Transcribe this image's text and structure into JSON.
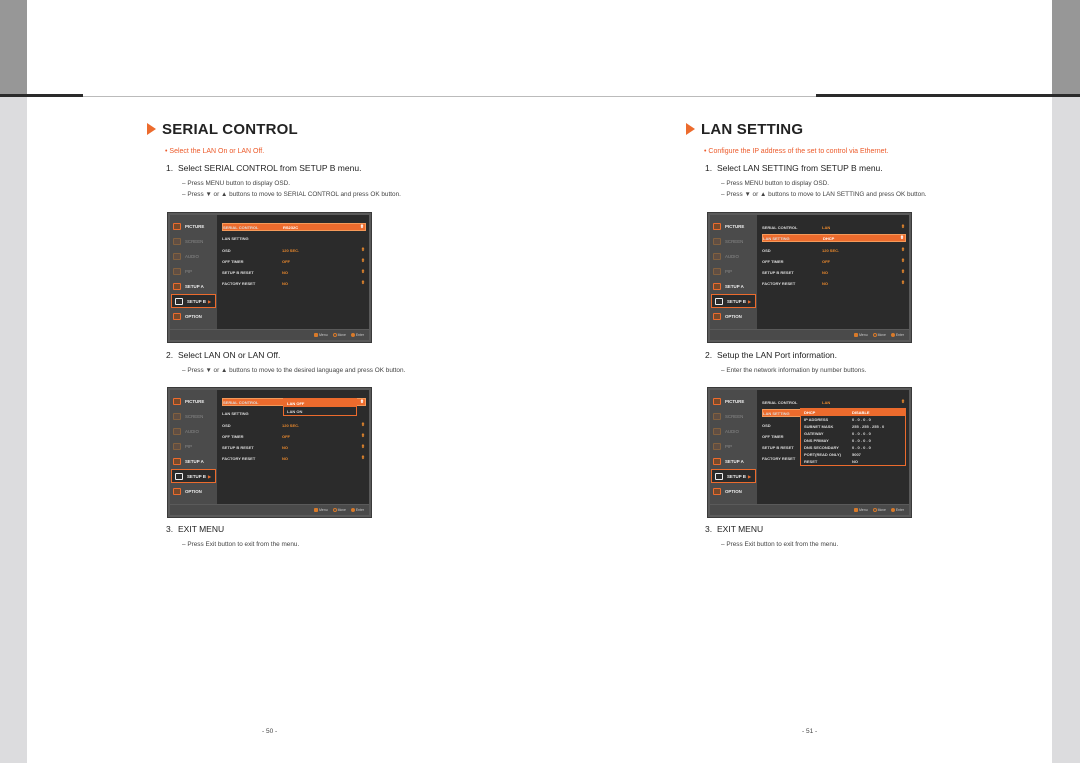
{
  "left_page": {
    "title": "SERIAL CONTROL",
    "note": "• Select the LAN On or LAN Off.",
    "steps": [
      {
        "num": "1.",
        "text": "Select SERIAL CONTROL from SETUP B menu.",
        "subs": [
          "–  Press MENU button to display OSD.",
          "–  Press ▼ or ▲ buttons to move to SERIAL CONTROL and press OK button."
        ]
      },
      {
        "num": "2.",
        "text": "Select LAN ON or LAN Off.",
        "subs": [
          "–  Press ▼ or ▲ buttons to move to the desired language and press OK button."
        ]
      },
      {
        "num": "3.",
        "text": "EXIT MENU",
        "subs": [
          "–  Press Exit button to exit from the menu."
        ]
      }
    ],
    "page_number": "- 50 -"
  },
  "right_page": {
    "title": "LAN SETTING",
    "note": "• Configure the IP address of the set to control via Ethernet.",
    "steps": [
      {
        "num": "1.",
        "text": "Select LAN SETTING from SETUP B menu.",
        "subs": [
          "–  Press MENU button to display OSD.",
          "–  Press ▼ or ▲ buttons to move to LAN SETTING and press OK button."
        ]
      },
      {
        "num": "2.",
        "text": "Setup the LAN Port information.",
        "subs": [
          "–  Enter the network information by number buttons."
        ]
      },
      {
        "num": "3.",
        "text": "EXIT MENU",
        "subs": [
          "–  Press Exit button to exit from the menu."
        ]
      }
    ],
    "page_number": "- 51 -"
  },
  "osd": {
    "sidebar": [
      {
        "label": "PICTURE",
        "icon": "picture-icon",
        "dim": false
      },
      {
        "label": "SCREEN",
        "icon": "screen-icon",
        "dim": true
      },
      {
        "label": "AUDIO",
        "icon": "audio-icon",
        "dim": true
      },
      {
        "label": "PIP",
        "icon": "pip-icon",
        "dim": true
      },
      {
        "label": "SETUP A",
        "icon": "setup-a-icon",
        "dim": false
      },
      {
        "label": "SETUP B",
        "icon": "setup-b-icon",
        "dim": false,
        "active": true
      },
      {
        "label": "OPTION",
        "icon": "option-icon",
        "dim": false
      }
    ],
    "footer": {
      "menu": "Menu",
      "move": "Move",
      "enter": "Enter"
    },
    "screen1": {
      "rows": [
        {
          "label": "SERIAL CONTROL",
          "value": "RS232C",
          "highlight": true
        },
        {
          "label": "LAN SETTING",
          "value": ""
        },
        {
          "label": "OSD",
          "value": "120 SEC."
        },
        {
          "label": "OFF TIMER",
          "value": "OFF"
        },
        {
          "label": "SETUP B RESET",
          "value": "NO"
        },
        {
          "label": "FACTORY RESET",
          "value": "NO"
        }
      ]
    },
    "screen2": {
      "rows": [
        {
          "label": "SERIAL CONTROL",
          "value": "",
          "highlight": true
        },
        {
          "label": "LAN SETTING",
          "value": ""
        },
        {
          "label": "OSD",
          "value": "120 SEC."
        },
        {
          "label": "OFF TIMER",
          "value": "OFF"
        },
        {
          "label": "SETUP B RESET",
          "value": "NO"
        },
        {
          "label": "FACTORY RESET",
          "value": "NO"
        }
      ],
      "popup": [
        "LAN OFF",
        "LAN ON"
      ]
    },
    "screen3": {
      "rows": [
        {
          "label": "SERIAL CONTROL",
          "value": "LAN"
        },
        {
          "label": "LAN SETTING",
          "value": "DHCP",
          "highlight": true
        },
        {
          "label": "OSD",
          "value": "120 SEC."
        },
        {
          "label": "OFF TIMER",
          "value": "OFF"
        },
        {
          "label": "SETUP B RESET",
          "value": "NO"
        },
        {
          "label": "FACTORY RESET",
          "value": "NO"
        }
      ]
    },
    "screen4": {
      "rows": [
        {
          "label": "SERIAL CONTROL",
          "value": "LAN"
        },
        {
          "label": "LAN SETTING",
          "value": "",
          "highlight": true
        },
        {
          "label": "OSD",
          "value": ""
        },
        {
          "label": "OFF TIMER",
          "value": ""
        },
        {
          "label": "SETUP B RESET",
          "value": ""
        },
        {
          "label": "FACTORY RESET",
          "value": ""
        }
      ],
      "popup": [
        {
          "label": "DHCP",
          "value": "DISABLE"
        },
        {
          "label": "IP ADDRESS",
          "value": "0   .   0   .   0   .   0"
        },
        {
          "label": "SUBNET MASK",
          "value": "255 . 255 . 255 .  0"
        },
        {
          "label": "GATEWAY",
          "value": "0   .   0   .   0   .   0"
        },
        {
          "label": "DNS PRIMAY",
          "value": "0   .   0   .   0   .   0"
        },
        {
          "label": "DNS SECONDARY",
          "value": "0   .   0   .   0   .   0"
        },
        {
          "label": "PORT(READ ONLY)",
          "value": "          5007"
        },
        {
          "label": "RESET",
          "value": "NO"
        }
      ]
    }
  }
}
